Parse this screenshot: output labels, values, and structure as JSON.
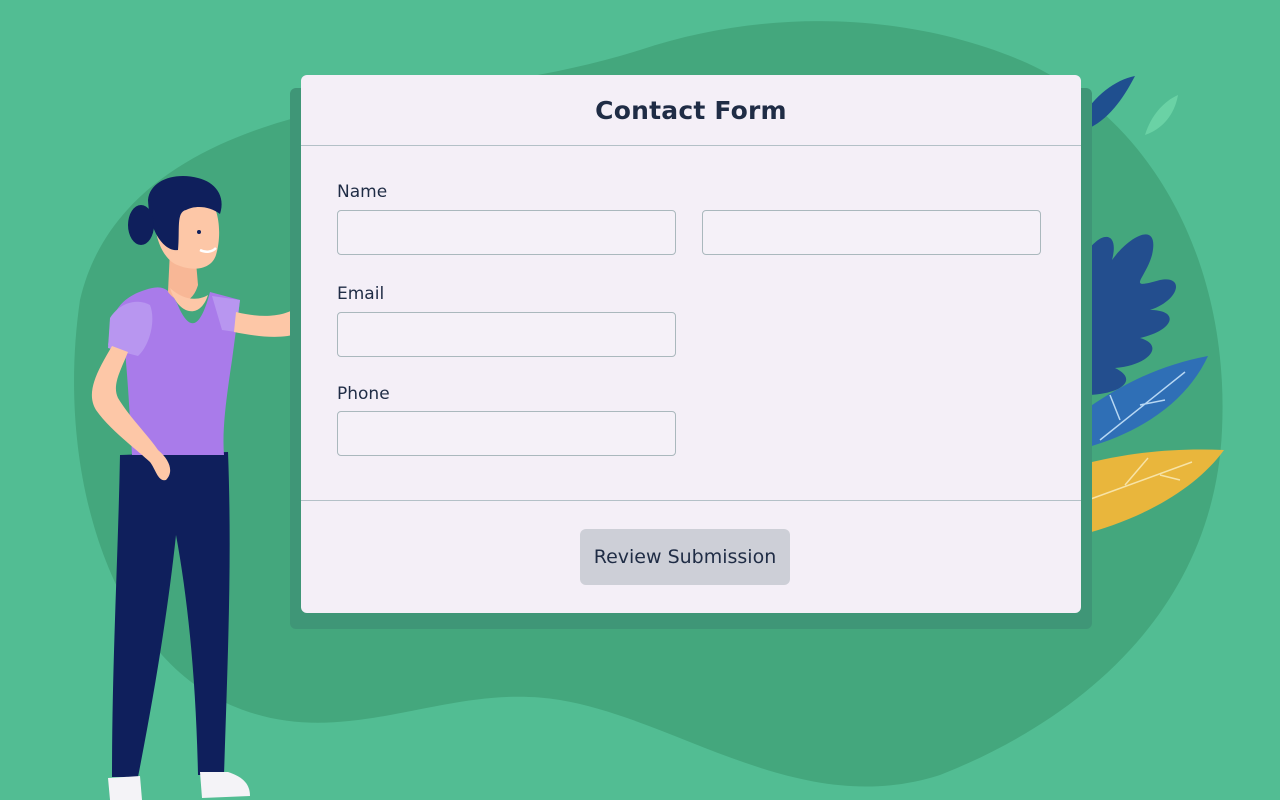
{
  "form": {
    "title": "Contact Form",
    "fields": {
      "name_label": "Name",
      "first_name_value": "",
      "last_name_value": "",
      "email_label": "Email",
      "email_value": "",
      "phone_label": "Phone",
      "phone_value": ""
    },
    "submit_label": "Review Submission"
  },
  "colors": {
    "background": "#52bd93",
    "card": "#f4eff7",
    "text": "#1f2c45",
    "button": "#cdcfd7"
  }
}
